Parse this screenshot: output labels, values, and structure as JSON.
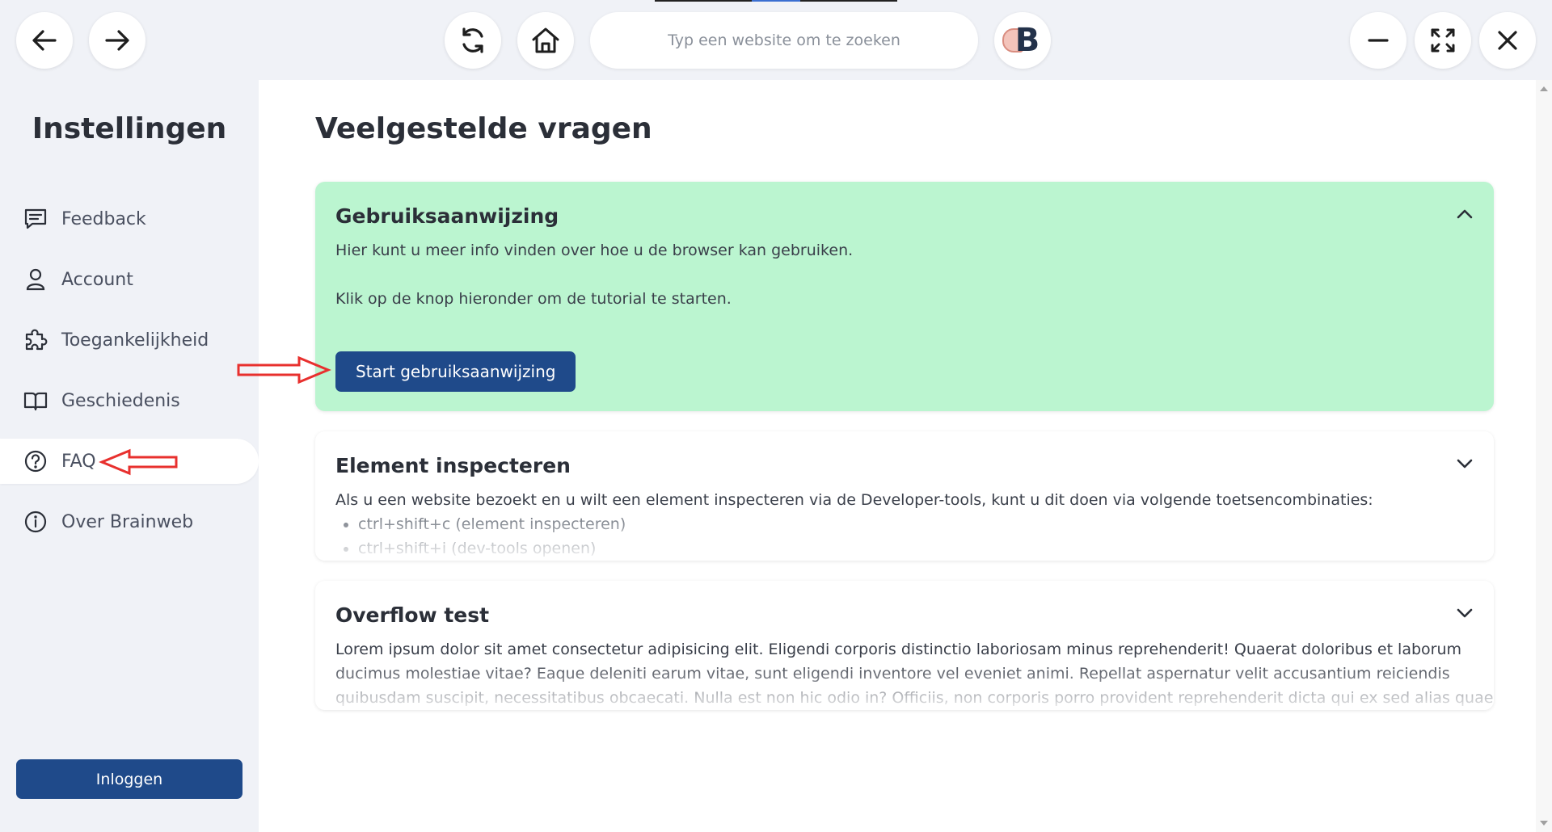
{
  "toolbar": {
    "back_icon": "arrow-left-icon",
    "forward_icon": "arrow-right-icon",
    "reload_icon": "reload-icon",
    "home_icon": "home-icon",
    "url_placeholder": "Typ een website om te zoeken",
    "brand_letter": "B",
    "minimize_icon": "minus-icon",
    "fullscreen_icon": "expand-icon",
    "close_icon": "close-icon"
  },
  "sidebar": {
    "title": "Instellingen",
    "items": [
      {
        "label": "Feedback",
        "icon": "feedback-icon",
        "active": false
      },
      {
        "label": "Account",
        "icon": "user-icon",
        "active": false
      },
      {
        "label": "Toegankelijkheid",
        "icon": "puzzle-icon",
        "active": false
      },
      {
        "label": "Geschiedenis",
        "icon": "book-icon",
        "active": false
      },
      {
        "label": "FAQ",
        "icon": "question-icon",
        "active": true
      },
      {
        "label": "Over Brainweb",
        "icon": "info-icon",
        "active": false
      }
    ],
    "login_label": "Inloggen"
  },
  "main": {
    "title": "Veelgestelde vragen",
    "faq": [
      {
        "title": "Gebruiksaanwijzing",
        "expanded": true,
        "lines": [
          "Hier kunt u meer info vinden over hoe u de browser kan gebruiken.",
          "Klik op de knop hieronder om de tutorial te starten."
        ],
        "button_label": "Start gebruiksaanwijzing"
      },
      {
        "title": "Element inspecteren",
        "expanded": false,
        "text": "Als u een website bezoekt en u wilt een element inspecteren via de Developer-tools, kunt u dit doen via volgende toetsencombinaties:",
        "list": [
          "ctrl+shift+c (element inspecteren)",
          "ctrl+shift+i (dev-tools openen)"
        ]
      },
      {
        "title": "Overflow test",
        "expanded": false,
        "lines": [
          "Lorem ipsum dolor sit amet consectetur adipisicing elit. Eligendi corporis distinctio laboriosam minus reprehenderit! Quaerat doloribus et laborum",
          "ducimus molestiae vitae? Eaque deleniti earum vitae, sunt eligendi inventore vel eveniet animi. Repellat aspernatur velit accusantium reiciendis",
          "quibusdam suscipit, necessitatibus obcaecati. Nulla est non hic odio in? Officiis, non corporis porro provident reprehenderit dicta qui ex sed alias quae,"
        ]
      }
    ]
  },
  "colors": {
    "primary": "#1f4a8a",
    "expanded_card": "#bbf5d0",
    "annotation": "#e8302e"
  }
}
